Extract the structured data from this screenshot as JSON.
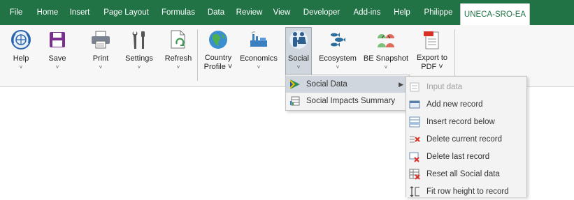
{
  "tabs": [
    "File",
    "Home",
    "Insert",
    "Page Layout",
    "Formulas",
    "Data",
    "Review",
    "View",
    "Developer",
    "Add-ins",
    "Help",
    "Philippe",
    "UNECA-SRO-EA"
  ],
  "ribbon": {
    "help": {
      "label": "Help",
      "chev": "˅"
    },
    "save": {
      "label": "Save",
      "chev": "˅"
    },
    "print": {
      "label": "Print",
      "chev": "˅"
    },
    "settings": {
      "label": "Settings",
      "chev": "˅"
    },
    "refresh": {
      "label": "Refresh",
      "chev": "˅"
    },
    "country": {
      "label1": "Country",
      "label2": "Profile ˅"
    },
    "economics": {
      "label": "Economics",
      "chev": "˅"
    },
    "social": {
      "label": "Social",
      "chev": "˅"
    },
    "ecosystem": {
      "label": "Ecosystem",
      "chev": "˅"
    },
    "snapshot": {
      "label": "BE Snapshot",
      "chev": "˅"
    },
    "export": {
      "label1": "Export to",
      "label2": "PDF ˅"
    }
  },
  "social_menu": {
    "items": [
      "Social Data",
      "Social Impacts Summary"
    ],
    "submenu_arrow": "▶"
  },
  "social_data_menu": {
    "items": [
      "Input data",
      "Add new record",
      "Insert record below",
      "Delete current record",
      "Delete last record",
      "Reset all Social data",
      "Fit row height to record"
    ]
  },
  "colors": {
    "brand": "#217346",
    "highlight": "#cfd6dd"
  }
}
